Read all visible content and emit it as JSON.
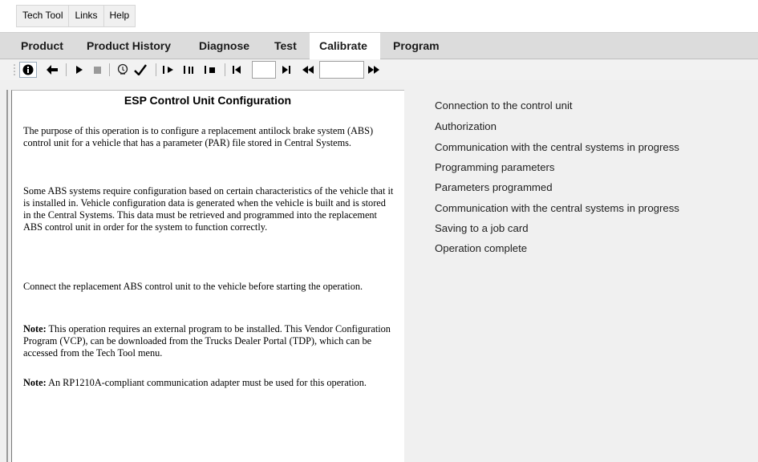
{
  "menu": [
    "Tech Tool",
    "Links",
    "Help"
  ],
  "tabs": [
    "Product",
    "Product History",
    "Diagnose",
    "Test",
    "Calibrate",
    "Program"
  ],
  "active_tab": "Calibrate",
  "content": {
    "title": "ESP Control Unit Configuration",
    "p1": "The purpose of this operation is to configure a replacement antilock brake system (ABS) control unit for a vehicle that has a parameter (PAR) file stored in Central Systems.",
    "p2": "Some ABS systems require configuration based on certain characteristics of the vehicle that it is installed in. Vehicle configuration data is generated when the vehicle is built and is stored in the Central Systems. This data must be retrieved and programmed into the replacement ABS control unit in order for the system to function correctly.",
    "p3": "Connect the replacement ABS control unit to the vehicle before starting the operation.",
    "note_label": "Note:",
    "note1": " This operation requires an external program to be installed. This Vendor Configuration Program (VCP), can be downloaded from the Trucks Dealer Portal (TDP), which can be accessed from the Tech Tool menu.",
    "note2": " An RP1210A-compliant communication adapter must be used for this operation."
  },
  "steps": [
    "Connection to the control unit",
    "Authorization",
    "Communication with the central systems in progress",
    "Programming parameters",
    "Parameters programmed",
    "Communication with the central systems in progress",
    "Saving to a job card",
    "Operation complete"
  ],
  "toolbar": {
    "icons": [
      "info-icon",
      "back-arrow-icon",
      "play-icon",
      "stop-icon",
      "lightbulb-hint-icon",
      "checkmark-icon",
      "step-forward-icon",
      "step-pause-icon",
      "step-stop-icon",
      "first-icon",
      "last-icon",
      "rewind-icon",
      "fast-forward-icon"
    ],
    "glyphs": {
      "play": "▶",
      "stop": "■",
      "check": "✓",
      "back": "←",
      "hint": "⚲",
      "first": "|◀",
      "last": "▶|",
      "rewind": "◀◀",
      "ff": "▶▶",
      "s1": "1▶",
      "s2": "1⏸",
      "s3": "1■"
    }
  }
}
